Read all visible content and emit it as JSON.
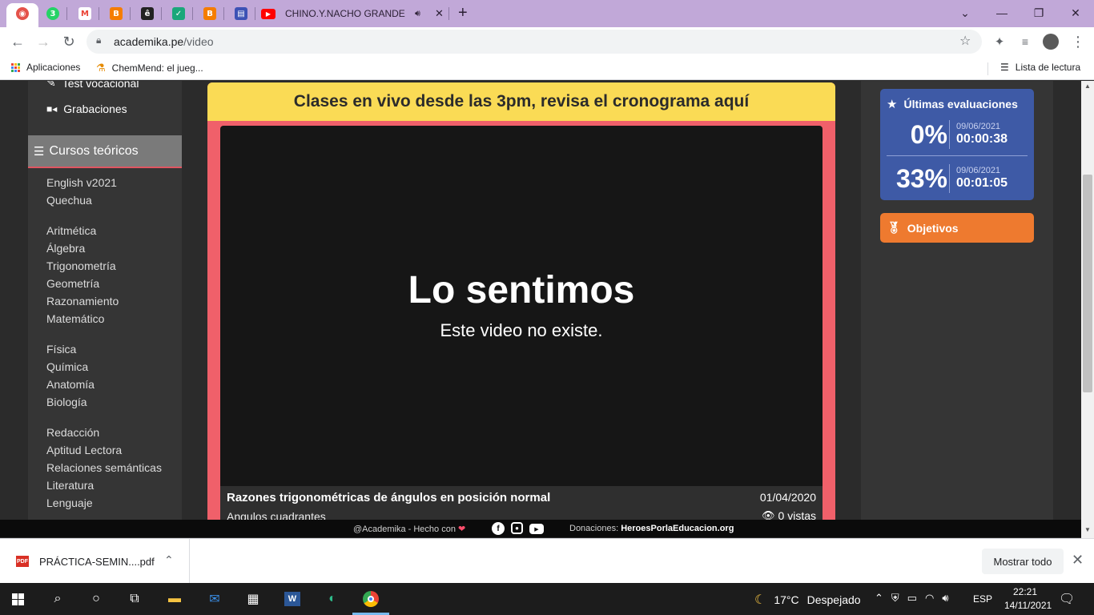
{
  "browser": {
    "tabs": [
      {
        "icon": "academika-icon",
        "color": "#e4524a",
        "glyph": "◉"
      },
      {
        "icon": "whatsapp-icon",
        "color": "#25d366",
        "glyph": "3"
      },
      {
        "icon": "gmail-icon",
        "color": "#ea4335",
        "glyph": "M"
      },
      {
        "icon": "blogger-icon",
        "color": "#f57d00",
        "glyph": "B"
      },
      {
        "icon": "e-icon",
        "color": "#222222",
        "glyph": "ê"
      },
      {
        "icon": "shield-check-icon",
        "color": "#1aa77a",
        "glyph": "✓"
      },
      {
        "icon": "blogger-icon",
        "color": "#f57d00",
        "glyph": "B"
      },
      {
        "icon": "calendar-icon",
        "color": "#3d52b5",
        "glyph": "▤"
      }
    ],
    "youtube_tab_title": "CHINO.Y.NACHO GRANDES É",
    "url_domain": "academika.pe",
    "url_path": "/video",
    "bookmarks": {
      "apps_label": "Aplicaciones",
      "chemmend_label": "ChemMend: el jueg...",
      "reading_list_label": "Lista de lectura"
    }
  },
  "sidebar": {
    "test_vocacional": "Test vocacional",
    "grabaciones": "Grabaciones",
    "cursos_header": "Cursos teóricos",
    "courses": [
      "English v2021",
      "Quechua",
      "Aritmética",
      "Álgebra",
      "Trigonometría",
      "Geometría",
      "Razonamiento",
      "Matemático",
      "Física",
      "Química",
      "Anatomía",
      "Biología",
      "Redacción",
      "Aptitud Lectora",
      "Relaciones semánticas",
      "Literatura",
      "Lenguaje"
    ]
  },
  "main": {
    "banner": "Clases en vivo desde las 3pm, revisa el cronograma aquí",
    "error_title": "Lo sentimos",
    "error_subtitle": "Este video no existe.",
    "video_title": "Razones trigonométricas de ángulos en posición normal",
    "video_subtitle": "Angulos cuadrantes",
    "video_date": "01/04/2020",
    "video_views": "0 vistas"
  },
  "right": {
    "eval_title": "Últimas evaluaciones",
    "evaluations": [
      {
        "percent": "0%",
        "date": "09/06/2021",
        "time": "00:00:38"
      },
      {
        "percent": "33%",
        "date": "09/06/2021",
        "time": "00:01:05"
      }
    ],
    "objectives": "Objetivos"
  },
  "footer": {
    "credit": "@Academika - Hecho con",
    "donations_label": "Donaciones:",
    "donations_link": "HeroesPorlaEducacion.org"
  },
  "downloads": {
    "file_name": "PRÁCTICA-SEMIN....pdf",
    "show_all": "Mostrar todo"
  },
  "taskbar": {
    "weather_temp": "17°C",
    "weather_text": "Despejado",
    "language": "ESP",
    "time": "22:21",
    "date": "14/11/2021"
  },
  "colors": {
    "tabstrip": "#c1a8d8",
    "banner": "#fadb55",
    "player_frame": "#f0606a",
    "eval_card": "#3e5aa6",
    "objectives_card": "#ee7a2f"
  }
}
